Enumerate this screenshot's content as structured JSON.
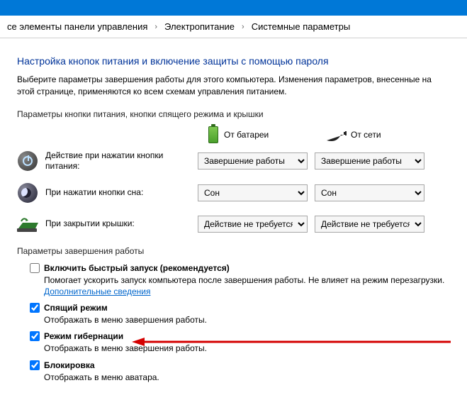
{
  "breadcrumb": {
    "crumb1": "се элементы панели управления",
    "crumb2": "Электропитание",
    "crumb3": "Системные параметры"
  },
  "page": {
    "title": "Настройка кнопок питания и включение защиты с помощью пароля",
    "subtitle": "Выберите параметры завершения работы для этого компьютера. Изменения параметров, внесенные на этой странице, применяются ко всем схемам управления питанием."
  },
  "section1": {
    "heading": "Параметры кнопки питания, кнопки спящего режима и крышки",
    "col_battery": "От батареи",
    "col_ac": "От сети",
    "rows": {
      "power_button": {
        "label": "Действие при нажатии кнопки питания:",
        "battery_value": "Завершение работы",
        "ac_value": "Завершение работы"
      },
      "sleep_button": {
        "label": "При нажатии кнопки сна:",
        "battery_value": "Сон",
        "ac_value": "Сон"
      },
      "lid": {
        "label": "При закрытии крышки:",
        "battery_value": "Действие не требуется",
        "ac_value": "Действие не требуется"
      }
    }
  },
  "section2": {
    "heading": "Параметры завершения работы",
    "fast_startup": {
      "label": "Включить быстрый запуск (рекомендуется)",
      "desc_prefix": "Помогает ускорить запуск компьютера после завершения работы. Не влияет на режим перезагрузки. ",
      "link": "Дополнительные сведения"
    },
    "sleep": {
      "label": "Спящий режим",
      "desc": "Отображать в меню завершения работы."
    },
    "hibernate": {
      "label": "Режим гибернации",
      "desc": "Отображать в меню завершения работы."
    },
    "lock": {
      "label": "Блокировка",
      "desc": "Отображать в меню аватара."
    }
  }
}
